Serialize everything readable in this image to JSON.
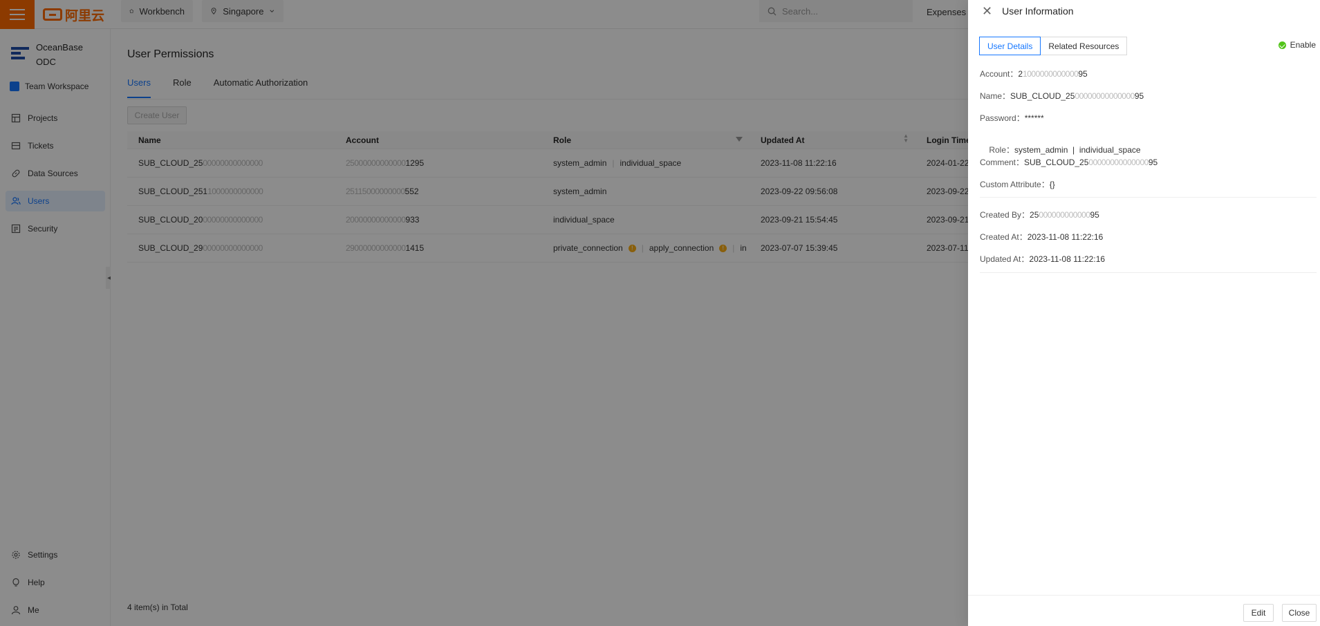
{
  "topbar": {
    "logo_text": "阿里云",
    "workbench": "Workbench",
    "region": "Singapore",
    "search_placeholder": "Search...",
    "expenses": "Expenses"
  },
  "sidebar": {
    "brand": "OceanBase ODC",
    "workspace": "Team Workspace",
    "items": [
      {
        "label": "Projects",
        "icon": "projects-icon"
      },
      {
        "label": "Tickets",
        "icon": "tickets-icon"
      },
      {
        "label": "Data Sources",
        "icon": "link-icon"
      },
      {
        "label": "Users",
        "icon": "users-icon",
        "active": true
      },
      {
        "label": "Security",
        "icon": "security-icon"
      }
    ],
    "bottom": [
      {
        "label": "Settings",
        "icon": "gear-icon"
      },
      {
        "label": "Help",
        "icon": "bulb-icon"
      },
      {
        "label": "Me",
        "icon": "user-icon"
      }
    ]
  },
  "main": {
    "title": "User Permissions",
    "tabs": [
      "Users",
      "Role",
      "Automatic Authorization"
    ],
    "create_button": "Create User",
    "columns": [
      "Name",
      "Account",
      "Role",
      "Updated At",
      "Login Time"
    ],
    "rows": [
      {
        "name_prefix": "SUB_CLOUD_25",
        "name_blur": "00000000000000",
        "account_blur": "25000000000000",
        "account_suffix": "1295",
        "roles": [
          "system_admin",
          "individual_space"
        ],
        "updated": "2023-11-08 11:22:16",
        "login": "2024-01-22"
      },
      {
        "name_prefix": "SUB_CLOUD_251",
        "name_blur": "1000000000000",
        "account_blur": "25115000000000",
        "account_suffix": "552",
        "roles": [
          "system_admin"
        ],
        "updated": "2023-09-22 09:56:08",
        "login": "2023-09-22"
      },
      {
        "name_prefix": "SUB_CLOUD_20",
        "name_blur": "00000000000000",
        "account_blur": "20000000000000",
        "account_suffix": "933",
        "roles": [
          "individual_space"
        ],
        "updated": "2023-09-21 15:54:45",
        "login": "2023-09-21"
      },
      {
        "name_prefix": "SUB_CLOUD_29",
        "name_blur": "00000000000000",
        "account_blur": "29000000000000",
        "account_suffix": "1415",
        "roles": [
          "private_connection",
          "apply_connection",
          "in"
        ],
        "updated": "2023-07-07 15:39:45",
        "login": "2023-07-11"
      }
    ],
    "total": "4 item(s) in Total"
  },
  "drawer": {
    "title": "User Information",
    "tabs": [
      "User Details",
      "Related Resources"
    ],
    "status": "Enable",
    "fields": {
      "account_label": "Account：",
      "account_prefix": "2",
      "account_blur": "1000000000000",
      "account_suffix": "95",
      "name_label": "Name：",
      "name_prefix": "SUB_CLOUD_25",
      "name_blur": "00000000000000",
      "name_suffix": "95",
      "password_label": "Password：",
      "password": "******",
      "role_label": "Role：",
      "role_value": "system_admin  |  individual_space",
      "comment_label": "Comment：",
      "comment_prefix": "SUB_CLOUD_25",
      "comment_blur": "00000000000000",
      "comment_suffix": "95",
      "custom_label": "Custom Attribute：",
      "custom_value": "{}",
      "created_by_label": "Created By：",
      "created_by_prefix": "25",
      "created_by_blur": "000000000000",
      "created_by_suffix": "95",
      "created_at_label": "Created At：",
      "created_at": "2023-11-08 11:22:16",
      "updated_at_label": "Updated At：",
      "updated_at": "2023-11-08 11:22:16"
    },
    "edit": "Edit",
    "close": "Close"
  },
  "colors": {
    "brand": "#ff6a00",
    "accent": "#1677ff",
    "success": "#52c41a",
    "warning": "#faad14"
  }
}
